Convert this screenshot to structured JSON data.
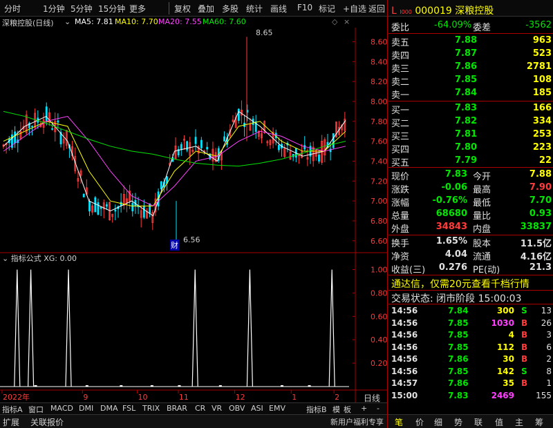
{
  "toolbar": {
    "items": [
      "分时",
      "1分钟",
      "5分钟",
      "15分钟",
      "更多",
      "复权",
      "叠加",
      "多股",
      "统计",
      "画线",
      "F10",
      "标记",
      "+自选",
      "返回"
    ]
  },
  "chart_header": {
    "name": "深粮控股(日线)",
    "ma5": "MA5: 7.81",
    "ma10": "MA10: 7.70",
    "ma20": "MA20: 7.55",
    "ma60": "MA60: 7.60",
    "colors": {
      "ma5": "#ffffff",
      "ma10": "#ffff00",
      "ma20": "#ff40ff",
      "ma60": "#00e600"
    }
  },
  "chart_data": [
    {
      "type": "line",
      "title": "深粮控股(日线)",
      "x": [
        "2022年",
        "9",
        "10",
        "11",
        "12",
        "1",
        "2"
      ],
      "yticks": [
        "8.60",
        "8.40",
        "8.20",
        "8.00",
        "7.80",
        "7.60",
        "7.40",
        "7.20",
        "7.00",
        "6.80",
        "6.60"
      ],
      "ylim": [
        6.55,
        8.7
      ],
      "series": [
        {
          "name": "MA5",
          "values": [
            7.55,
            7.75,
            7.85,
            7.6,
            7.0,
            6.9,
            7.0,
            6.85,
            7.5,
            7.55,
            7.4,
            7.9,
            7.75,
            7.55,
            7.45,
            7.5,
            7.81
          ]
        },
        {
          "name": "MA10",
          "values": [
            7.6,
            7.7,
            7.8,
            7.75,
            7.3,
            7.0,
            6.95,
            6.95,
            7.3,
            7.5,
            7.45,
            7.75,
            7.8,
            7.6,
            7.5,
            7.5,
            7.7
          ]
        },
        {
          "name": "MA20",
          "values": [
            7.5,
            7.65,
            7.8,
            7.85,
            7.6,
            7.3,
            7.05,
            6.95,
            7.15,
            7.4,
            7.45,
            7.6,
            7.7,
            7.65,
            7.55,
            7.5,
            7.55
          ]
        },
        {
          "name": "MA60",
          "values": [
            7.9,
            7.85,
            7.78,
            7.7,
            7.62,
            7.55,
            7.5,
            7.47,
            7.42,
            7.38,
            7.36,
            7.35,
            7.38,
            7.42,
            7.48,
            7.55,
            7.6
          ]
        }
      ],
      "annotations": [
        "8.65",
        "6.56",
        "财"
      ]
    },
    {
      "type": "bar",
      "title": "指标公式 XG: 0.00",
      "yticks": [
        "1.00",
        "0.80",
        "0.60",
        "0.40",
        "0.20"
      ],
      "ylim": [
        0,
        1.05
      ],
      "signals_at": [
        0.04,
        0.08,
        0.19,
        0.56,
        0.72,
        0.96
      ]
    }
  ],
  "sub_header": "指标公式 XG: 0.00",
  "x_labels": [
    "2022年",
    "9",
    "10",
    "11",
    "12",
    "1",
    "2"
  ],
  "x_right_label": "日线",
  "bottom_tabs": [
    "指标A",
    "窗口",
    "MACD",
    "DMI",
    "DMA",
    "FSL",
    "TRIX",
    "BRAR",
    "CR",
    "VR",
    "OBV",
    "ASI",
    "EMV",
    "指标B",
    "模",
    "板",
    "+",
    "-"
  ],
  "status_left": [
    "扩展",
    "关联报价"
  ],
  "status_mid": "新用户福利专享",
  "status_tabs": [
    "笔",
    "价",
    "细",
    "势",
    "联",
    "值",
    "主",
    "筹"
  ],
  "quote": {
    "code": "000019",
    "name": "深粮控股",
    "l_label": "L",
    "l_sub": "I000",
    "webi_label": "委比",
    "webi": "-64.09%",
    "wecha_label": "委差",
    "wecha": "-3562",
    "asks": [
      {
        "label": "卖五",
        "price": "7.88",
        "vol": "963"
      },
      {
        "label": "卖四",
        "price": "7.87",
        "vol": "523"
      },
      {
        "label": "卖三",
        "price": "7.86",
        "vol": "2781"
      },
      {
        "label": "卖二",
        "price": "7.85",
        "vol": "108"
      },
      {
        "label": "卖一",
        "price": "7.84",
        "vol": "185"
      }
    ],
    "bids": [
      {
        "label": "买一",
        "price": "7.83",
        "vol": "166"
      },
      {
        "label": "买二",
        "price": "7.82",
        "vol": "334"
      },
      {
        "label": "买三",
        "price": "7.81",
        "vol": "253"
      },
      {
        "label": "买四",
        "price": "7.80",
        "vol": "223"
      },
      {
        "label": "买五",
        "price": "7.79",
        "vol": "22"
      }
    ],
    "stats": [
      {
        "l": "现价",
        "lv": "7.83",
        "r": "今开",
        "rv": "7.88"
      },
      {
        "l": "涨跌",
        "lv": "-0.06",
        "r": "最高",
        "rv": "7.90"
      },
      {
        "l": "涨幅",
        "lv": "-0.76%",
        "r": "最低",
        "rv": "7.70"
      },
      {
        "l": "总量",
        "lv": "68680",
        "r": "量比",
        "rv": "0.93"
      },
      {
        "l": "外盘",
        "lv": "34843",
        "r": "内盘",
        "rv": "33837"
      }
    ],
    "stats2": [
      {
        "l": "换手",
        "lv": "1.65%",
        "r": "股本",
        "rv": "11.5亿"
      },
      {
        "l": "净资",
        "lv": "4.04",
        "r": "流通",
        "rv": "4.16亿"
      },
      {
        "l": "收益(三)",
        "lv": "0.276",
        "r": "PE(动)",
        "rv": "21.3"
      }
    ],
    "promo": "通达信，仅需20元查看千档行情",
    "trade_status": "交易状态: 闭市阶段 15:00:03",
    "ticks": [
      {
        "t": "14:56",
        "p": "7.84",
        "v": "300",
        "d": "S",
        "n": "13"
      },
      {
        "t": "14:56",
        "p": "7.85",
        "v": "1030",
        "d": "B",
        "n": "26"
      },
      {
        "t": "14:56",
        "p": "7.85",
        "v": "4",
        "d": "B",
        "n": "3"
      },
      {
        "t": "14:56",
        "p": "7.85",
        "v": "112",
        "d": "B",
        "n": "6"
      },
      {
        "t": "14:56",
        "p": "7.86",
        "v": "30",
        "d": "B",
        "n": "2"
      },
      {
        "t": "14:56",
        "p": "7.85",
        "v": "142",
        "d": "S",
        "n": "8"
      },
      {
        "t": "14:57",
        "p": "7.86",
        "v": "35",
        "d": "B",
        "n": "1"
      },
      {
        "t": "15:00",
        "p": "7.83",
        "v": "2469",
        "d": "",
        "n": "155"
      }
    ]
  }
}
